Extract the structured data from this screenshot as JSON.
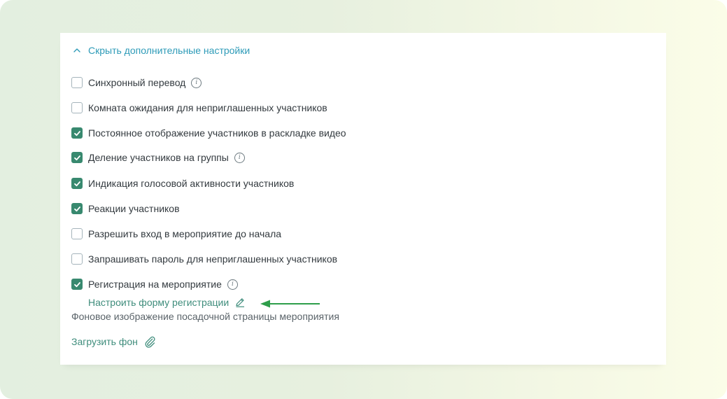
{
  "toggle": {
    "label": "Скрыть дополнительные настройки",
    "icon": "chevron-up-icon"
  },
  "options": [
    {
      "label": "Синхронный перевод",
      "checked": false,
      "info": true
    },
    {
      "label": "Комната ожидания для неприглашенных участников",
      "checked": false,
      "info": false
    },
    {
      "label": "Постоянное отображение участников в раскладке видео",
      "checked": true,
      "info": false
    },
    {
      "label": "Деление участников на группы",
      "checked": true,
      "info": true
    },
    {
      "label": "Индикация голосовой активности участников",
      "checked": true,
      "info": false
    },
    {
      "label": "Реакции участников",
      "checked": true,
      "info": false
    },
    {
      "label": "Разрешить вход в мероприятие до начала",
      "checked": false,
      "info": false
    },
    {
      "label": "Запрашивать пароль для неприглашенных участников",
      "checked": false,
      "info": false
    },
    {
      "label": "Регистрация на мероприятие",
      "checked": true,
      "info": true
    }
  ],
  "registration_form": {
    "label": "Настроить форму регистрации",
    "icon": "pencil-icon"
  },
  "background": {
    "label": "Фоновое изображение посадочной страницы мероприятия",
    "upload_label": "Загрузить фон",
    "upload_icon": "paperclip-icon"
  },
  "colors": {
    "accent_link": "#2e9bb8",
    "checkbox_checked": "#38896f",
    "arrow": "#2e9e4a",
    "text": "#333a3f"
  }
}
